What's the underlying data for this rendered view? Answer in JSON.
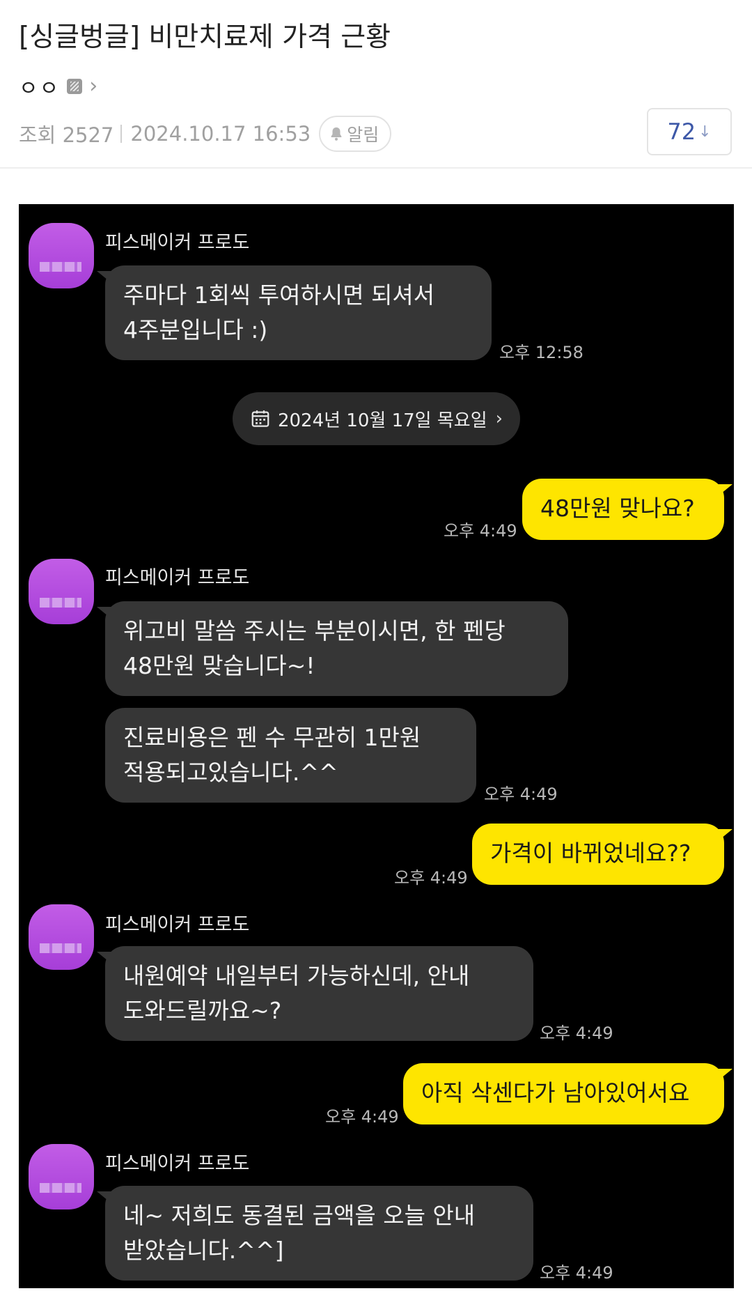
{
  "post": {
    "title": "[싱글벙글] 비만치료제 가격 근황",
    "author": "ㅇㅇ",
    "author_level_icon": "level-icon",
    "views_label": "조회 2527",
    "datetime": "2024.10.17 16:53",
    "alarm_label": "알림",
    "comment_count": "72",
    "comment_arrow": "↓"
  },
  "chat": {
    "date_divider": "2024년 10월 17일 목요일",
    "messages": [
      {
        "side": "other",
        "sender": "피스메이커 프로도",
        "lines": [
          "주마다 1회씩 투여하시면 되셔서",
          "4주분입니다 :)"
        ],
        "time": "오후 12:58"
      },
      {
        "side": "me",
        "lines": [
          "48만원 맞나요?"
        ],
        "time": "오후 4:49"
      },
      {
        "side": "other",
        "sender": "피스메이커 프로도",
        "lines": [
          "위고비 말씀 주시는 부분이시면, 한 펜당",
          "48만원 맞습니다~!"
        ]
      },
      {
        "side": "other",
        "lines": [
          "진료비용은 펜 수 무관히 1만원",
          "적용되고있습니다.^^"
        ],
        "time": "오후 4:49"
      },
      {
        "side": "me",
        "lines": [
          "가격이 바뀌었네요??"
        ],
        "time": "오후 4:49"
      },
      {
        "side": "other",
        "sender": "피스메이커 프로도",
        "lines": [
          "내원예약 내일부터 가능하신데, 안내",
          "도와드릴까요~?"
        ],
        "time": "오후 4:49"
      },
      {
        "side": "me",
        "lines": [
          "아직 삭센다가 남아있어서요"
        ],
        "time": "오후 4:49"
      },
      {
        "side": "other",
        "sender": "피스메이커 프로도",
        "lines": [
          "네~ 저희도 동결된 금액을 오늘 안내",
          "받았습니다.^^]"
        ],
        "time": "오후 4:49"
      }
    ]
  },
  "colors": {
    "chat_background": "#000000",
    "other_bubble": "#363636",
    "my_bubble": "#fee500",
    "avatar": "#b04ddf",
    "comment_count": "#3d58a8"
  }
}
